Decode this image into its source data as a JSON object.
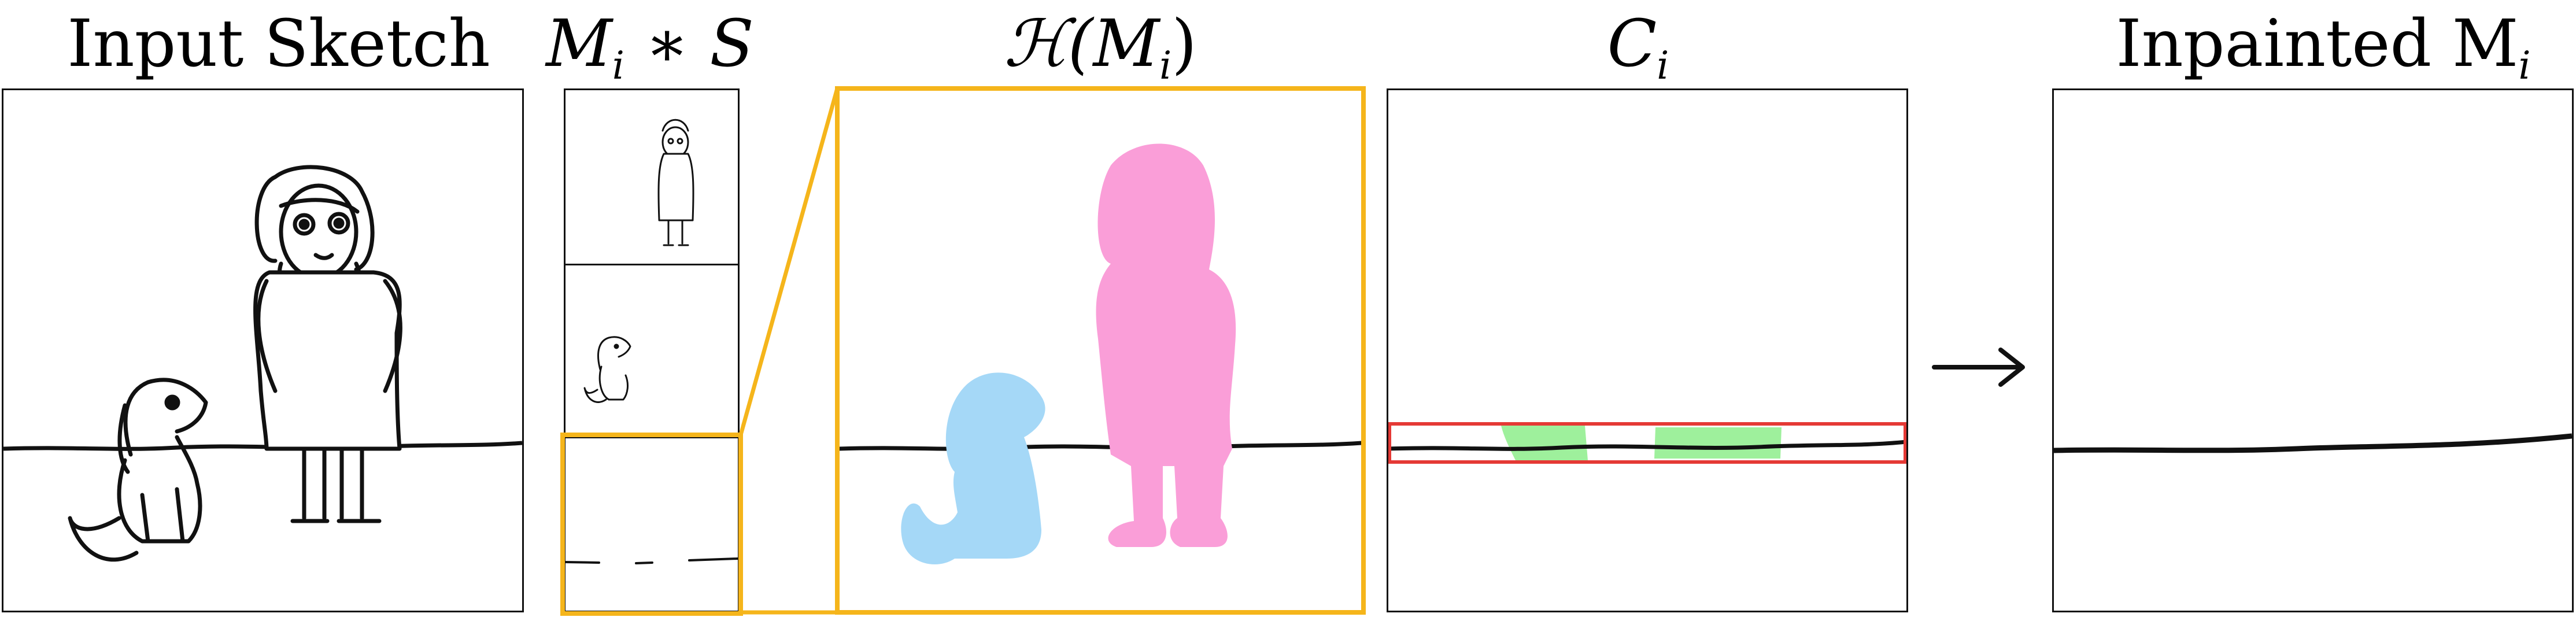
{
  "titles": {
    "input_sketch": "Input Sketch",
    "masked_sketch_base": "M",
    "masked_sketch_sub": "i",
    "masked_sketch_rest": " ∗ S",
    "hull_prefix": "ℋ(M",
    "hull_sub": "i",
    "hull_suffix": ")",
    "conflict_base": "C",
    "conflict_sub": "i",
    "inpainted_prefix": "Inpainted M",
    "inpainted_sub": "i"
  },
  "arrow_icon": "right-arrow-icon",
  "colors": {
    "zoom_highlight": "#F5B51B",
    "conflict_box": "#E53935",
    "conflict_fill": "#9EF09C",
    "dog_hull": "#A5D8F7",
    "girl_hull": "#FA9ED8",
    "stroke": "#111111",
    "panel_border": "#111111"
  }
}
